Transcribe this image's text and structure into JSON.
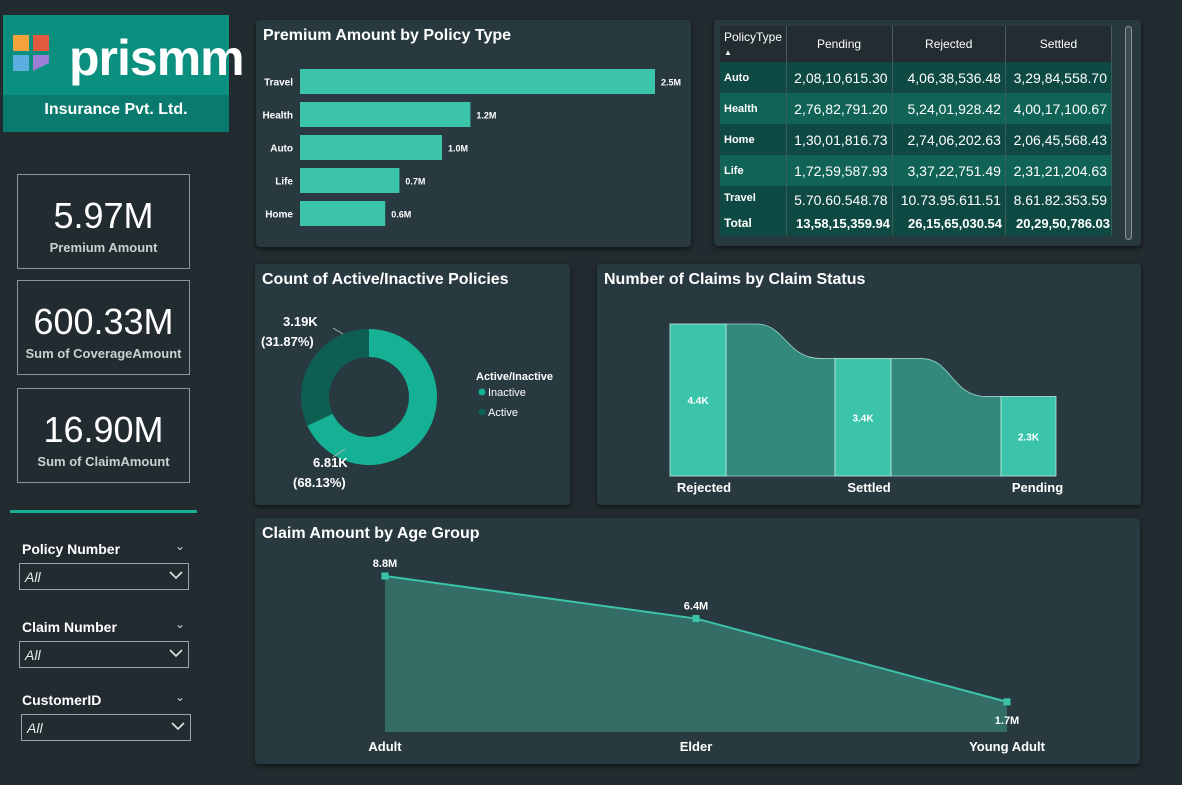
{
  "brand": {
    "logo_word": "prismm",
    "subtitle": "Insurance Pvt. Ltd.",
    "colors": {
      "teal": "#0b8f7f",
      "accent": "#16b195",
      "bar": "#3cc4aa"
    }
  },
  "kpis": [
    {
      "value": "5.97M",
      "label": "Premium Amount"
    },
    {
      "value": "600.33M",
      "label": "Sum of CoverageAmount"
    },
    {
      "value": "16.90M",
      "label": "Sum of ClaimAmount"
    }
  ],
  "slicers": [
    {
      "label": "Policy Number",
      "value": "All"
    },
    {
      "label": "Claim Number",
      "value": "All"
    },
    {
      "label": "CustomerID",
      "value": "All"
    }
  ],
  "premium_chart": {
    "title": "Premium Amount by Policy Type"
  },
  "table": {
    "headers": [
      "PolicyType",
      "Pending",
      "Rejected",
      "Settled"
    ],
    "rows": [
      [
        "Auto",
        "2,08,10,615.30",
        "4,06,38,536.48",
        "3,29,84,558.70"
      ],
      [
        "Health",
        "2,76,82,791.20",
        "5,24,01,928.42",
        "4,00,17,100.67"
      ],
      [
        "Home",
        "1,30,01,816.73",
        "2,74,06,202.63",
        "2,06,45,568.43"
      ],
      [
        "Life",
        "1,72,59,587.93",
        "3,37,22,751.49",
        "2,31,21,204.63"
      ],
      [
        "Travel",
        "5.70.60.548.78",
        "10.73.95.611.51",
        "8.61.82.353.59"
      ]
    ],
    "total": [
      "Total",
      "13,58,15,359.94",
      "26,15,65,030.54",
      "20,29,50,786.03"
    ]
  },
  "donut_chart": {
    "title": "Count of Active/Inactive Policies",
    "legend_title": "Active/Inactive",
    "top_label_value": "3.19K",
    "top_label_pct": "(31.87%)",
    "bottom_label_value": "6.81K",
    "bottom_label_pct": "(68.13%)"
  },
  "funnel_chart": {
    "title": "Number of Claims by Claim Status"
  },
  "area_chart": {
    "title": "Claim Amount by Age Group"
  },
  "chart_data": [
    {
      "type": "bar",
      "orientation": "horizontal",
      "title": "Premium Amount by Policy Type",
      "categories": [
        "Travel",
        "Health",
        "Auto",
        "Life",
        "Home"
      ],
      "values": [
        2.5,
        1.2,
        1.0,
        0.7,
        0.6
      ],
      "labels": [
        "2.5M",
        "1.2M",
        "1.0M",
        "0.7M",
        "0.6M"
      ],
      "unit": "M",
      "color": "#3cc4aa",
      "xlim": [
        0,
        2.5
      ],
      "grid": false
    },
    {
      "type": "pie",
      "donut": true,
      "title": "Count of Active/Inactive Policies",
      "series": [
        {
          "name": "Inactive",
          "value": 6.81,
          "label": "6.81K",
          "pct": 68.13,
          "color": "#16b195"
        },
        {
          "name": "Active",
          "value": 3.19,
          "label": "3.19K",
          "pct": 31.87,
          "color": "#0f5e52"
        }
      ],
      "legend_title": "Active/Inactive",
      "legend_position": "right"
    },
    {
      "type": "bar",
      "variant": "ribbon",
      "title": "Number of Claims by Claim Status",
      "categories": [
        "Rejected",
        "Settled",
        "Pending"
      ],
      "values": [
        4.4,
        3.4,
        2.3
      ],
      "labels": [
        "4.4K",
        "3.4K",
        "2.3K"
      ],
      "unit": "K",
      "color": "#3cc4aa",
      "ribbon_color": "#338a7c"
    },
    {
      "type": "area",
      "title": "Claim Amount by Age Group",
      "categories": [
        "Adult",
        "Elder",
        "Young Adult"
      ],
      "values": [
        8.8,
        6.4,
        1.7
      ],
      "labels": [
        "8.8M",
        "6.4M",
        "1.7M"
      ],
      "unit": "M",
      "ylim": [
        0,
        8.8
      ],
      "line_color": "#3cc4aa",
      "fill_color": "#346d66",
      "grid": false
    }
  ]
}
